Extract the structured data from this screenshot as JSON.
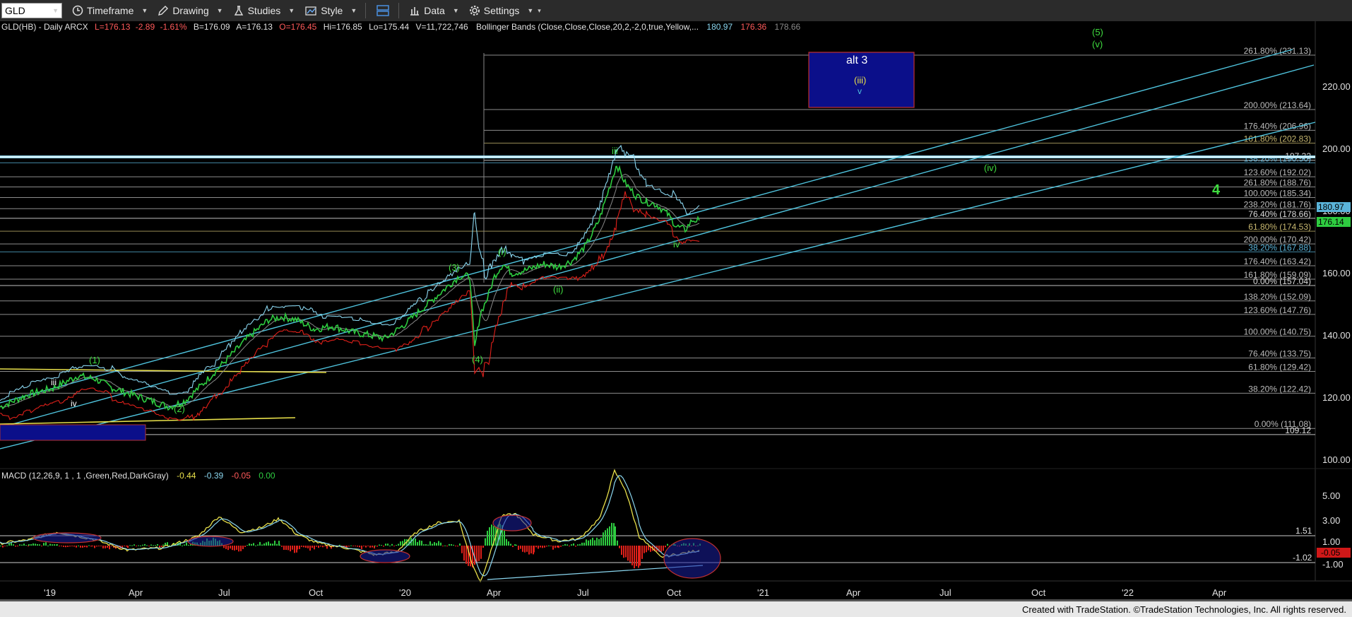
{
  "toolbar": {
    "symbol": "GLD",
    "timeframe": "Timeframe",
    "drawing": "Drawing",
    "studies": "Studies",
    "style": "Style",
    "data": "Data",
    "settings": "Settings"
  },
  "header": {
    "instrument": "GLD(HB) - Daily  ARCX",
    "last": "L=176.13",
    "change": "-2.89",
    "pct": "-1.61%",
    "bid": "B=176.09",
    "ask": "A=176.13",
    "open": "O=176.45",
    "high": "Hi=176.85",
    "low": "Lo=175.44",
    "volume": "V=11,722,746",
    "study": "Bollinger Bands (Close,Close,Close,20,2,-2,0,true,Yellow,...",
    "bb_upper": "180.97",
    "bb_lower": "176.36",
    "bb_mid": "178.66"
  },
  "macd_header": {
    "label": "MACD (12,26,9, 1 , 1 ,Green,Red,DarkGray)",
    "v1": "-0.44",
    "v2": "-0.39",
    "v3": "-0.05",
    "v4": "0.00"
  },
  "price_axis": [
    "220.00",
    "200.00",
    "180.00",
    "160.00",
    "140.00",
    "120.00",
    "100.00"
  ],
  "macd_axis": [
    "5.00",
    "3.00",
    "1.00",
    "-1.00"
  ],
  "price_badges": {
    "upper": "180.97",
    "last": "176.14"
  },
  "macd_badges": {
    "upper": "1.51",
    "current": "-0.05",
    "lower": "-1.02"
  },
  "x_axis": [
    "'19",
    "Apr",
    "Jul",
    "Oct",
    "'20",
    "Apr",
    "Jul",
    "Oct",
    "'21",
    "Apr",
    "Jul",
    "Oct",
    "'22",
    "Apr"
  ],
  "fib_levels": [
    {
      "label": "261.80% (231.13)",
      "value": 231.13,
      "color": "#bbbbbb"
    },
    {
      "label": "200.00% (213.64)",
      "value": 213.64,
      "color": "#bbbbbb"
    },
    {
      "label": "176.40% (206.96)",
      "value": 206.96,
      "color": "#bbbbbb"
    },
    {
      "label": "161.80% (202.83)",
      "value": 202.83,
      "color": "#c8b870"
    },
    {
      "label": "197.32",
      "value": 197.32,
      "color": "#ffffff"
    },
    {
      "label": "138.20% (196.50)",
      "value": 196.5,
      "color": "#5ab3d9"
    },
    {
      "label": "123.60% (192.02)",
      "value": 192.02,
      "color": "#bbbbbb"
    },
    {
      "label": "261.80% (188.76)",
      "value": 188.76,
      "color": "#bbbbbb"
    },
    {
      "label": "100.00% (185.34)",
      "value": 185.34,
      "color": "#bbbbbb"
    },
    {
      "label": "238.20% (181.76)",
      "value": 181.76,
      "color": "#bbbbbb"
    },
    {
      "label": "76.40% (178.66)",
      "value": 178.66,
      "color": "#ffffff"
    },
    {
      "label": "61.80% (174.53)",
      "value": 174.53,
      "color": "#c8b870"
    },
    {
      "label": "200.00% (170.42)",
      "value": 170.42,
      "color": "#bbbbbb"
    },
    {
      "label": "38.20% (167.88)",
      "value": 167.88,
      "color": "#5ab3d9"
    },
    {
      "label": "176.40% (163.42)",
      "value": 163.42,
      "color": "#bbbbbb"
    },
    {
      "label": "161.80% (159.09)",
      "value": 159.09,
      "color": "#bbbbbb"
    },
    {
      "label": "0.00% (157.04)",
      "value": 157.04,
      "color": "#ffffff"
    },
    {
      "label": "138.20% (152.09)",
      "value": 152.09,
      "color": "#bbbbbb"
    },
    {
      "label": "123.60% (147.76)",
      "value": 147.76,
      "color": "#bbbbbb"
    },
    {
      "label": "100.00% (140.75)",
      "value": 140.75,
      "color": "#bbbbbb"
    },
    {
      "label": "76.40% (133.75)",
      "value": 133.75,
      "color": "#bbbbbb"
    },
    {
      "label": "61.80% (129.42)",
      "value": 129.42,
      "color": "#bbbbbb"
    },
    {
      "label": "38.20% (122.42)",
      "value": 122.42,
      "color": "#bbbbbb"
    },
    {
      "label": "0.00% (111.08)",
      "value": 111.08,
      "color": "#bbbbbb"
    },
    {
      "label": "109.12",
      "value": 109.12,
      "color": "#ffffff"
    }
  ],
  "wave_labels": {
    "w1": "(1)",
    "w2": "(2)",
    "w3": "(3)",
    "w4": "(4)",
    "wi": "(i)",
    "wii": "(ii)",
    "wiii_top": "iii",
    "wiv_low": "iv",
    "wiii_small": "iii",
    "wiv_small": "iv",
    "alt": "alt 3",
    "alt_iii": "(iii)",
    "alt_v": "v",
    "iv_target": "(iv)",
    "five": "(5)",
    "v_target": "(v)",
    "four": "4"
  },
  "colors": {
    "price": "#2ecc40",
    "bb": "#8ad6ef",
    "bb_low": "#e0201a",
    "channel": "#4fc3dd",
    "yellow": "#e8e04a",
    "box": "#0b0f8a",
    "wave": "#3fdc3f"
  },
  "footer": "Created with TradeStation. ©TradeStation Technologies, Inc. All rights reserved."
}
